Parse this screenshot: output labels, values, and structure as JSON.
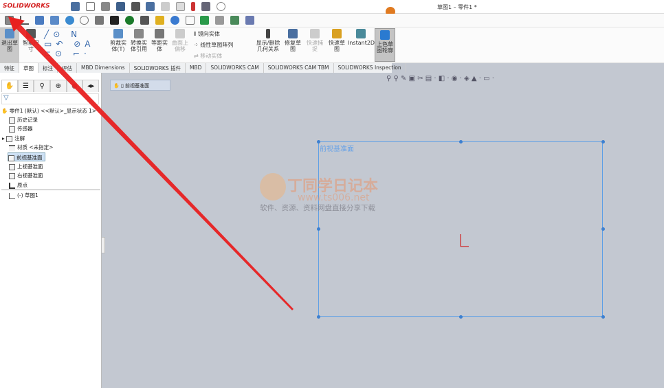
{
  "app": {
    "logo": "SOLIDWORKS",
    "window_title": "草图1 – 零件1 *"
  },
  "ribbon": {
    "exit_sketch": "退出草图",
    "smart_dim": "智能尺寸",
    "trim": "剪裁实体(T)",
    "convert": "转换实体引用",
    "offset": "等距实体",
    "surface_offset": "曲面上偏移",
    "mirror": "镜向实体",
    "linear_pattern": "线性草图阵列",
    "move": "移动实体",
    "relations": "显示/删除几何关系",
    "repair": "修复草图",
    "quick_snap": "快速捕捉",
    "rapid_sketch": "快速草图",
    "instant2d": "Instant2D",
    "shaded": "上色草图轮廓"
  },
  "tabs": [
    "特征",
    "草图",
    "标注",
    "评估",
    "MBD Dimensions",
    "SOLIDWORKS 插件",
    "MBD",
    "SOLIDWORKS CAM",
    "SOLIDWORKS CAM TBM",
    "SOLIDWORKS Inspection"
  ],
  "tree": {
    "root": "零件1 (默认) <<默认>_显示状态 1>",
    "items": [
      "历史记录",
      "传感器",
      "注解",
      "材质 <未指定>",
      "前视基准面",
      "上视基准面",
      "右视基准面",
      "原点",
      "(-) 草图1"
    ]
  },
  "breadcrumb": "前视基准面",
  "canvas": {
    "plane_label": "前视基准面"
  },
  "watermark": {
    "title": "丁同学日记本",
    "url": "www.ts006.net",
    "slogan": "软件、资源、资料网盘直接分享下载"
  },
  "colors": {
    "sketch": "#5d9fe6",
    "arrow": "#e82020"
  }
}
